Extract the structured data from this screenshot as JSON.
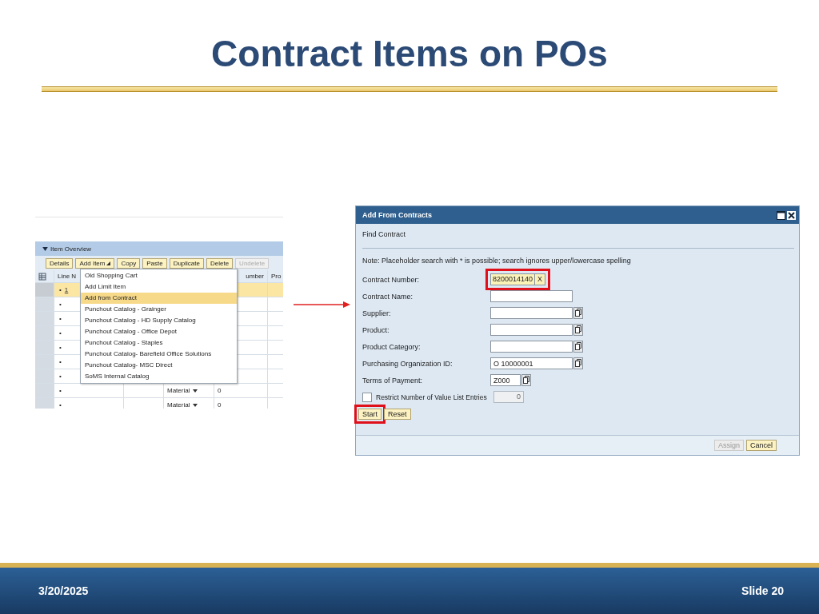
{
  "slide": {
    "title": "Contract Items on POs",
    "date": "3/20/2025",
    "number": "Slide 20"
  },
  "item_overview": {
    "title": "Item Overview",
    "expanded": true,
    "toolbar": [
      {
        "label": "Details",
        "disabled": false,
        "kind": "plain"
      },
      {
        "label": "Add Item",
        "disabled": false,
        "kind": "menu"
      },
      {
        "label": "Copy",
        "disabled": false,
        "kind": "plain"
      },
      {
        "label": "Paste",
        "disabled": false,
        "kind": "plain"
      },
      {
        "label": "Duplicate",
        "disabled": false,
        "kind": "plain"
      },
      {
        "label": "Delete",
        "disabled": false,
        "kind": "plain"
      },
      {
        "label": "Undelete",
        "disabled": true,
        "kind": "plain"
      }
    ],
    "columns": [
      "Line N",
      "umber",
      "Pro"
    ],
    "rows": [
      {
        "bullet": "•",
        "line": "1",
        "selected": true
      },
      {
        "bullet": "•",
        "selected": false
      },
      {
        "bullet": "•",
        "selected": false
      },
      {
        "bullet": "•",
        "selected": false
      },
      {
        "bullet": "•",
        "selected": false
      },
      {
        "bullet": "•",
        "selected": false
      },
      {
        "bullet": "•",
        "selected": false
      },
      {
        "bullet": "•",
        "type": "Material",
        "value": "0",
        "selected": false
      },
      {
        "bullet": "•",
        "type": "Material",
        "value": "0",
        "selected": false
      }
    ],
    "menu": [
      {
        "label": "Old Shopping Cart",
        "selected": false
      },
      {
        "label": "Add Limit Item",
        "selected": false
      },
      {
        "label": "Add from Contract",
        "selected": true
      },
      {
        "label": "Punchout Catalog - Grainger",
        "selected": false
      },
      {
        "label": "Punchout Catalog - HD Supply Catalog",
        "selected": false
      },
      {
        "label": "Punchout Catalog - Office Depot",
        "selected": false
      },
      {
        "label": "Punchout Catalog - Staples",
        "selected": false
      },
      {
        "label": "Punchout Catalog- Barefield Office Solutions",
        "selected": false
      },
      {
        "label": "Punchout Catalog- MSC Direct",
        "selected": false
      },
      {
        "label": "SoMS Internal Catalog",
        "selected": false
      }
    ]
  },
  "dialog": {
    "title": "Add From Contracts",
    "section": "Find Contract",
    "note": "Note: Placeholder search with * is possible; search ignores upper/lowercase spelling",
    "fields": [
      {
        "label": "Contract Number:",
        "kind": "clearable",
        "value": "8200014140",
        "clear": "X",
        "highlighted": true
      },
      {
        "label": "Contract Name:",
        "kind": "text",
        "highlighted": false
      },
      {
        "label": "Supplier:",
        "kind": "lookup",
        "highlighted": false
      },
      {
        "label": "Product:",
        "kind": "lookup",
        "highlighted": false
      },
      {
        "label": "Product Category:",
        "kind": "lookup",
        "highlighted": false
      },
      {
        "label": "Purchasing Organization ID:",
        "kind": "lookup",
        "value": "O 10000001",
        "highlighted": false
      },
      {
        "label": "Terms of Payment:",
        "kind": "short",
        "value": "Z000",
        "highlighted": false
      }
    ],
    "restrict": {
      "label": "Restrict Number of Value List Entries",
      "checked": false,
      "value": "0"
    },
    "buttons": [
      {
        "label": "Start",
        "highlighted": true
      },
      {
        "label": "Reset",
        "highlighted": false
      }
    ],
    "footer_buttons": [
      {
        "label": "Assign",
        "disabled": true
      },
      {
        "label": "Cancel",
        "disabled": false
      }
    ]
  }
}
